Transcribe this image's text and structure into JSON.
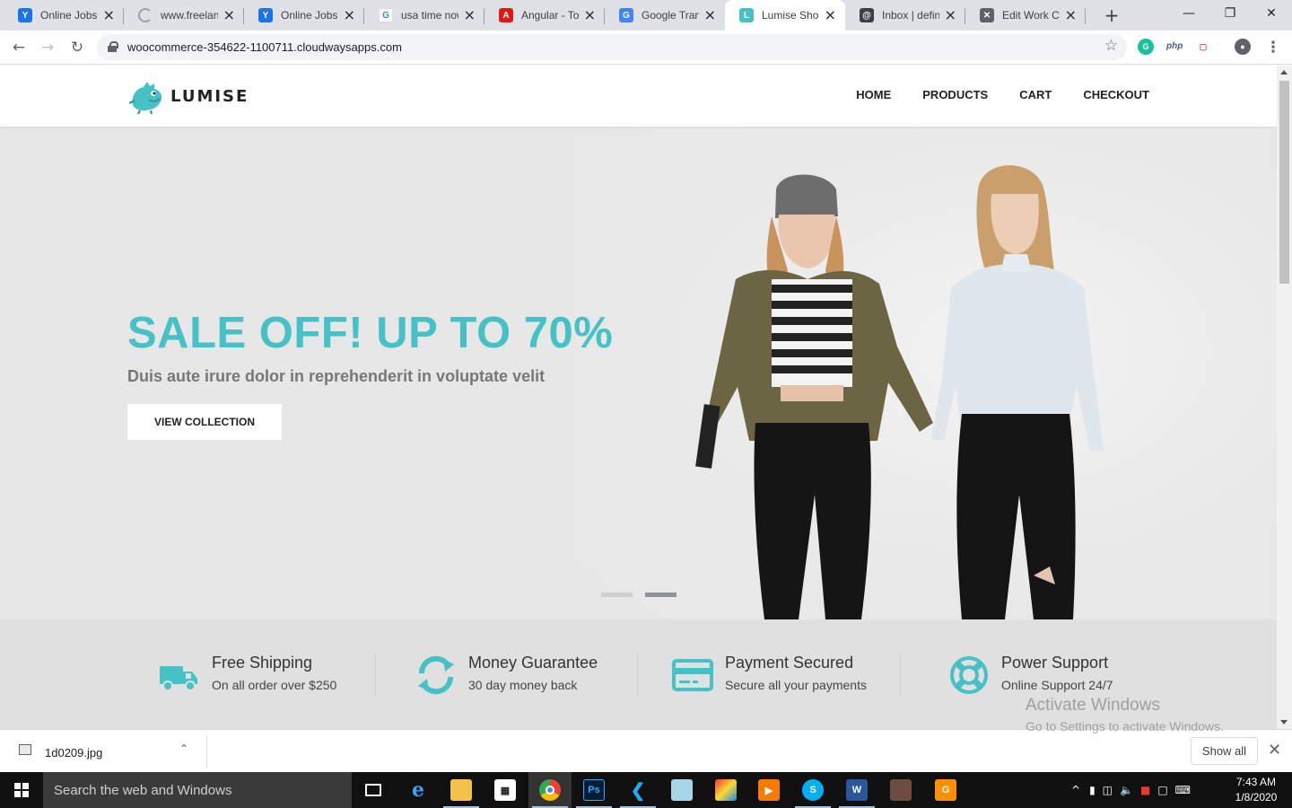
{
  "browser": {
    "tabs": [
      {
        "title": "Online Jobs |",
        "icon": "y-job-icon",
        "color": "#1a73e8",
        "glyph": "Y"
      },
      {
        "title": "www.freelanc",
        "icon": "loading-icon",
        "color": "#9aa0a6",
        "glyph": ""
      },
      {
        "title": "Online Jobs |",
        "icon": "y-job-icon",
        "color": "#1a73e8",
        "glyph": "Y"
      },
      {
        "title": "usa time now",
        "icon": "google-icon",
        "color": "#ffffff",
        "glyph": "G"
      },
      {
        "title": "Angular - Tou",
        "icon": "angular-icon",
        "color": "#dd1b16",
        "glyph": "A"
      },
      {
        "title": "Google Transl",
        "icon": "translate-icon",
        "color": "#4285f4",
        "glyph": "G"
      },
      {
        "title": "Lumise Shop",
        "icon": "lumise-icon",
        "color": "#46c2c6",
        "glyph": "L"
      },
      {
        "title": "Inbox | define",
        "icon": "inbox-icon",
        "color": "#3c4043",
        "glyph": "@"
      },
      {
        "title": "Edit Work Co",
        "icon": "tools-icon",
        "color": "#5f6368",
        "glyph": "✕"
      }
    ],
    "active_tab": 6,
    "url": "woocommerce-354622-1100711.cloudwaysapps.com",
    "extensions": [
      {
        "name": "grammarly-icon",
        "glyph": "G",
        "bg": "#15c39a",
        "fg": "#ffffff"
      },
      {
        "name": "php-icon",
        "glyph": "php",
        "bg": "#ffffff",
        "fg": "#4f5b93"
      },
      {
        "name": "pocket-icon",
        "glyph": "▢",
        "bg": "#ffffff",
        "fg": "#ef4056"
      }
    ]
  },
  "site": {
    "brand": "LUMISE",
    "nav": [
      "HOME",
      "PRODUCTS",
      "CART",
      "CHECKOUT"
    ],
    "hero": {
      "title": "SALE OFF! UP TO 70%",
      "subtitle": "Duis aute irure dolor in reprehenderit in voluptate velit",
      "button": "VIEW COLLECTION",
      "slides": 2,
      "active_slide": 2
    },
    "features": [
      {
        "title": "Free Shipping",
        "desc": "On all order over $250",
        "icon": "truck-icon"
      },
      {
        "title": "Money Guarantee",
        "desc": "30 day money back",
        "icon": "refresh-icon"
      },
      {
        "title": "Payment Secured",
        "desc": "Secure all your payments",
        "icon": "credit-card-icon"
      },
      {
        "title": "Power Support",
        "desc": "Online Support 24/7",
        "icon": "lifebuoy-icon"
      }
    ],
    "accent": "#46c2c6"
  },
  "watermark": {
    "line1": "Activate Windows",
    "line2": "Go to Settings to activate Windows."
  },
  "downloads": {
    "file": "1d0209.jpg",
    "show_all": "Show all"
  },
  "taskbar": {
    "search_placeholder": "Search the web and Windows",
    "time": "7:43 AM",
    "date": "1/8/2020"
  }
}
